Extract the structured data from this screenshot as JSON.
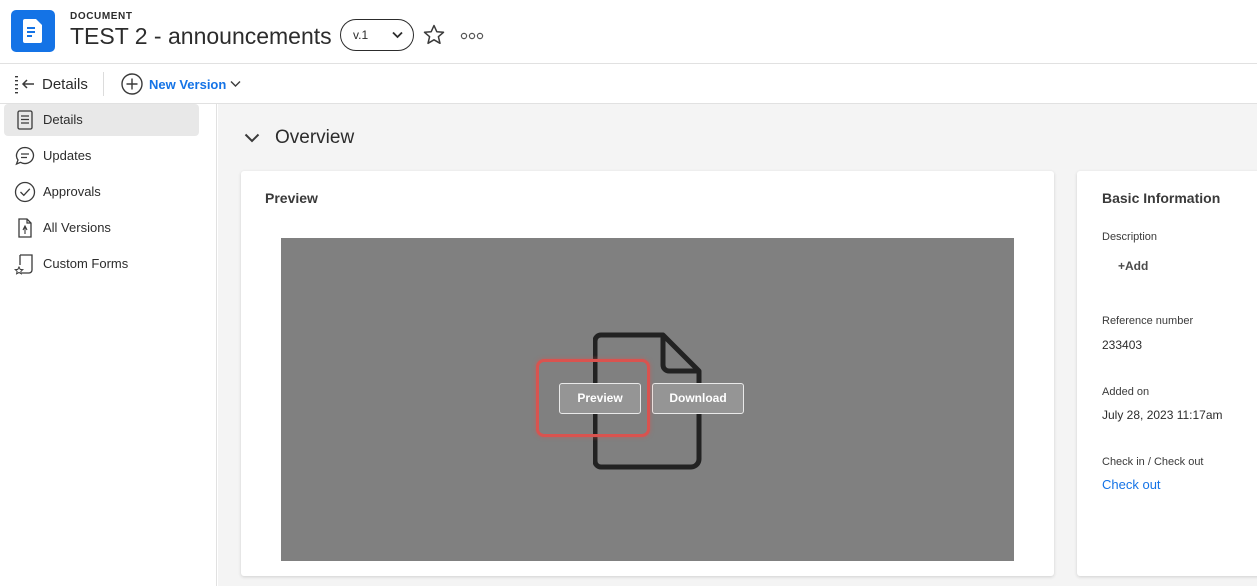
{
  "header": {
    "doc_type": "DOCUMENT",
    "title": "TEST 2 - announcements",
    "version": "v.1",
    "accent_color": "#1473e6"
  },
  "toolbar": {
    "panel_title": "Details",
    "new_version_label": "New Version"
  },
  "sidebar": {
    "items": [
      {
        "label": "Details",
        "icon": "document-lines-icon",
        "active": true
      },
      {
        "label": "Updates",
        "icon": "chat-bubble-icon",
        "active": false
      },
      {
        "label": "Approvals",
        "icon": "checkmark-circle-icon",
        "active": false
      },
      {
        "label": "All Versions",
        "icon": "file-versions-icon",
        "active": false
      },
      {
        "label": "Custom Forms",
        "icon": "form-icon",
        "active": false
      }
    ]
  },
  "overview": {
    "title": "Overview"
  },
  "preview_card": {
    "title": "Preview",
    "preview_button": "Preview",
    "download_button": "Download",
    "highlight_color": "#d9534f"
  },
  "info": {
    "title": "Basic Information",
    "description_label": "Description",
    "add_label": "+Add",
    "reference_label": "Reference number",
    "reference_value": "233403",
    "added_label": "Added on",
    "added_value": "July 28, 2023 11:17am",
    "checkin_label": "Check in / Check out",
    "checkout_link": "Check out"
  }
}
